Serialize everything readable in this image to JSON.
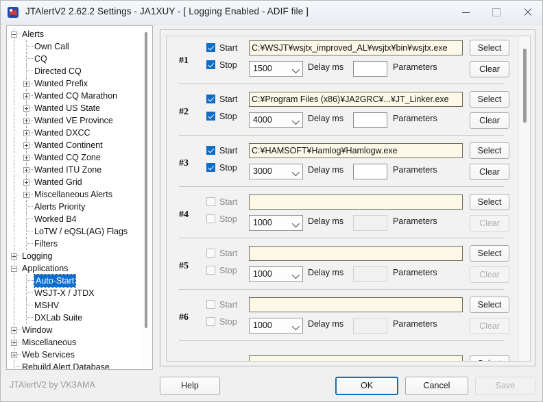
{
  "window": {
    "title": "JTAlertV2  2.62.2 Settings  -  JA1XUY  -  [ Logging Enabled - ADIF file ]",
    "icon": "jtalert-logo-icon",
    "minimize_label": "Minimize",
    "maximize_label": "Maximize",
    "close_label": "Close",
    "accent_color": "#0d6dc7",
    "selection_color": "#0b6fd1",
    "path_field_bg": "#fdf9e9"
  },
  "tree": {
    "nodes": [
      {
        "label": "Alerts",
        "depth": 0,
        "state": "expanded",
        "selected": false
      },
      {
        "label": "Own Call",
        "depth": 1,
        "state": "leaf",
        "selected": false
      },
      {
        "label": "CQ",
        "depth": 1,
        "state": "leaf",
        "selected": false
      },
      {
        "label": "Directed CQ",
        "depth": 1,
        "state": "leaf",
        "selected": false
      },
      {
        "label": "Wanted Prefix",
        "depth": 1,
        "state": "collapsed",
        "selected": false
      },
      {
        "label": "Wanted CQ Marathon",
        "depth": 1,
        "state": "collapsed",
        "selected": false
      },
      {
        "label": "Wanted US State",
        "depth": 1,
        "state": "collapsed",
        "selected": false
      },
      {
        "label": "Wanted VE Province",
        "depth": 1,
        "state": "collapsed",
        "selected": false
      },
      {
        "label": "Wanted DXCC",
        "depth": 1,
        "state": "collapsed",
        "selected": false
      },
      {
        "label": "Wanted Continent",
        "depth": 1,
        "state": "collapsed",
        "selected": false
      },
      {
        "label": "Wanted CQ Zone",
        "depth": 1,
        "state": "collapsed",
        "selected": false
      },
      {
        "label": "Wanted ITU Zone",
        "depth": 1,
        "state": "collapsed",
        "selected": false
      },
      {
        "label": "Wanted Grid",
        "depth": 1,
        "state": "collapsed",
        "selected": false
      },
      {
        "label": "Miscellaneous Alerts",
        "depth": 1,
        "state": "collapsed",
        "selected": false
      },
      {
        "label": "Alerts Priority",
        "depth": 1,
        "state": "leaf",
        "selected": false
      },
      {
        "label": "Worked B4",
        "depth": 1,
        "state": "leaf",
        "selected": false
      },
      {
        "label": "LoTW / eQSL(AG) Flags",
        "depth": 1,
        "state": "leaf",
        "selected": false
      },
      {
        "label": "Filters",
        "depth": 1,
        "state": "leaf",
        "selected": false
      },
      {
        "label": "Logging",
        "depth": 0,
        "state": "collapsed",
        "selected": false
      },
      {
        "label": "Applications",
        "depth": 0,
        "state": "expanded",
        "selected": false
      },
      {
        "label": "Auto-Start",
        "depth": 1,
        "state": "leaf",
        "selected": true
      },
      {
        "label": "WSJT-X / JTDX",
        "depth": 1,
        "state": "leaf",
        "selected": false
      },
      {
        "label": "MSHV",
        "depth": 1,
        "state": "leaf",
        "selected": false
      },
      {
        "label": "DXLab Suite",
        "depth": 1,
        "state": "leaf",
        "selected": false
      },
      {
        "label": "Window",
        "depth": 0,
        "state": "collapsed",
        "selected": false
      },
      {
        "label": "Miscellaneous",
        "depth": 0,
        "state": "collapsed",
        "selected": false
      },
      {
        "label": "Web Services",
        "depth": 0,
        "state": "collapsed",
        "selected": false
      },
      {
        "label": "Rebuild Alert Database",
        "depth": 0,
        "state": "leaf",
        "selected": false
      }
    ]
  },
  "labels": {
    "start": "Start",
    "stop": "Stop",
    "delay_ms": "Delay ms",
    "parameters": "Parameters",
    "select": "Select",
    "clear": "Clear"
  },
  "rows": [
    {
      "number": "#1",
      "start_checked": true,
      "stop_checked": true,
      "path": "C:¥WSJT¥wsjtx_improved_AL¥wsjtx¥bin¥wsjtx.exe",
      "delay": "1500",
      "parameters": "",
      "enabled": true
    },
    {
      "number": "#2",
      "start_checked": true,
      "stop_checked": true,
      "path": "C:¥Program Files (x86)¥JA2GRC¥...¥JT_Linker.exe",
      "delay": "4000",
      "parameters": "",
      "enabled": true
    },
    {
      "number": "#3",
      "start_checked": true,
      "stop_checked": true,
      "path": "C:¥HAMSOFT¥Hamlog¥Hamlogw.exe",
      "delay": "3000",
      "parameters": "",
      "enabled": true
    },
    {
      "number": "#4",
      "start_checked": false,
      "stop_checked": false,
      "path": "",
      "delay": "1000",
      "parameters": "",
      "enabled": false
    },
    {
      "number": "#5",
      "start_checked": false,
      "stop_checked": false,
      "path": "",
      "delay": "1000",
      "parameters": "",
      "enabled": false
    },
    {
      "number": "#6",
      "start_checked": false,
      "stop_checked": false,
      "path": "",
      "delay": "1000",
      "parameters": "",
      "enabled": false
    }
  ],
  "footer": {
    "credit": "JTAlertV2 by VK3AMA",
    "help": "Help",
    "ok": "OK",
    "cancel": "Cancel",
    "save": "Save"
  }
}
